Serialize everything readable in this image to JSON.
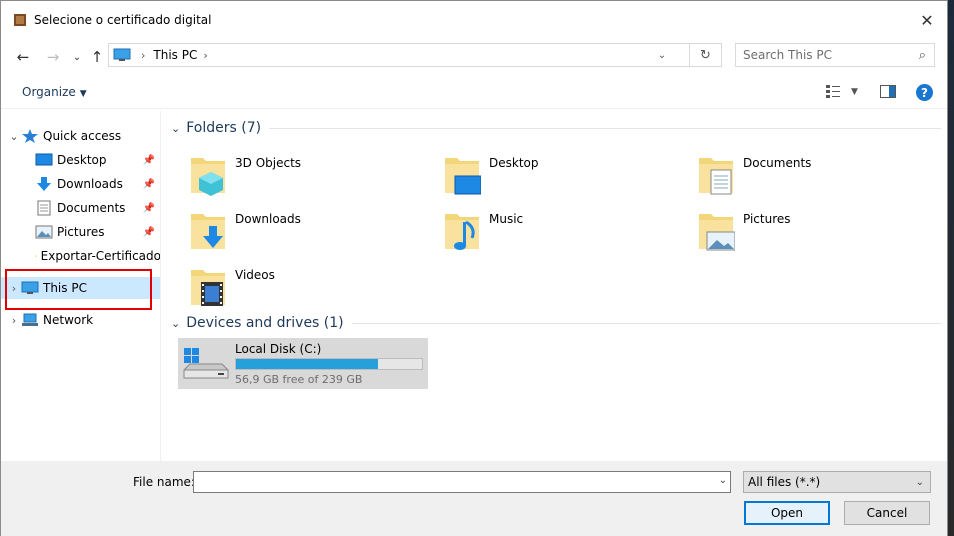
{
  "window": {
    "title": "Selecione o certificado digital"
  },
  "address": {
    "crumb": "This PC"
  },
  "search": {
    "placeholder": "Search This PC"
  },
  "toolbar": {
    "organize_label": "Organize"
  },
  "nav": {
    "quick_access": "Quick access",
    "items": [
      {
        "label": "Desktop"
      },
      {
        "label": "Downloads"
      },
      {
        "label": "Documents"
      },
      {
        "label": "Pictures"
      },
      {
        "label": "Exportar-Certificado"
      }
    ],
    "this_pc": "This PC",
    "network": "Network"
  },
  "content": {
    "folders_header": "Folders (7)",
    "folders": [
      {
        "name": "3D Objects"
      },
      {
        "name": "Desktop"
      },
      {
        "name": "Documents"
      },
      {
        "name": "Downloads"
      },
      {
        "name": "Music"
      },
      {
        "name": "Pictures"
      },
      {
        "name": "Videos"
      }
    ],
    "drives_header": "Devices and drives (1)",
    "drive": {
      "name": "Local Disk (C:)",
      "free_text": "56,9 GB free of 239 GB",
      "used_fraction": 0.762
    }
  },
  "bottom": {
    "file_name_label": "File name:",
    "file_name_value": "",
    "filter_value": "All files (*.*)",
    "open_label": "Open",
    "cancel_label": "Cancel"
  }
}
